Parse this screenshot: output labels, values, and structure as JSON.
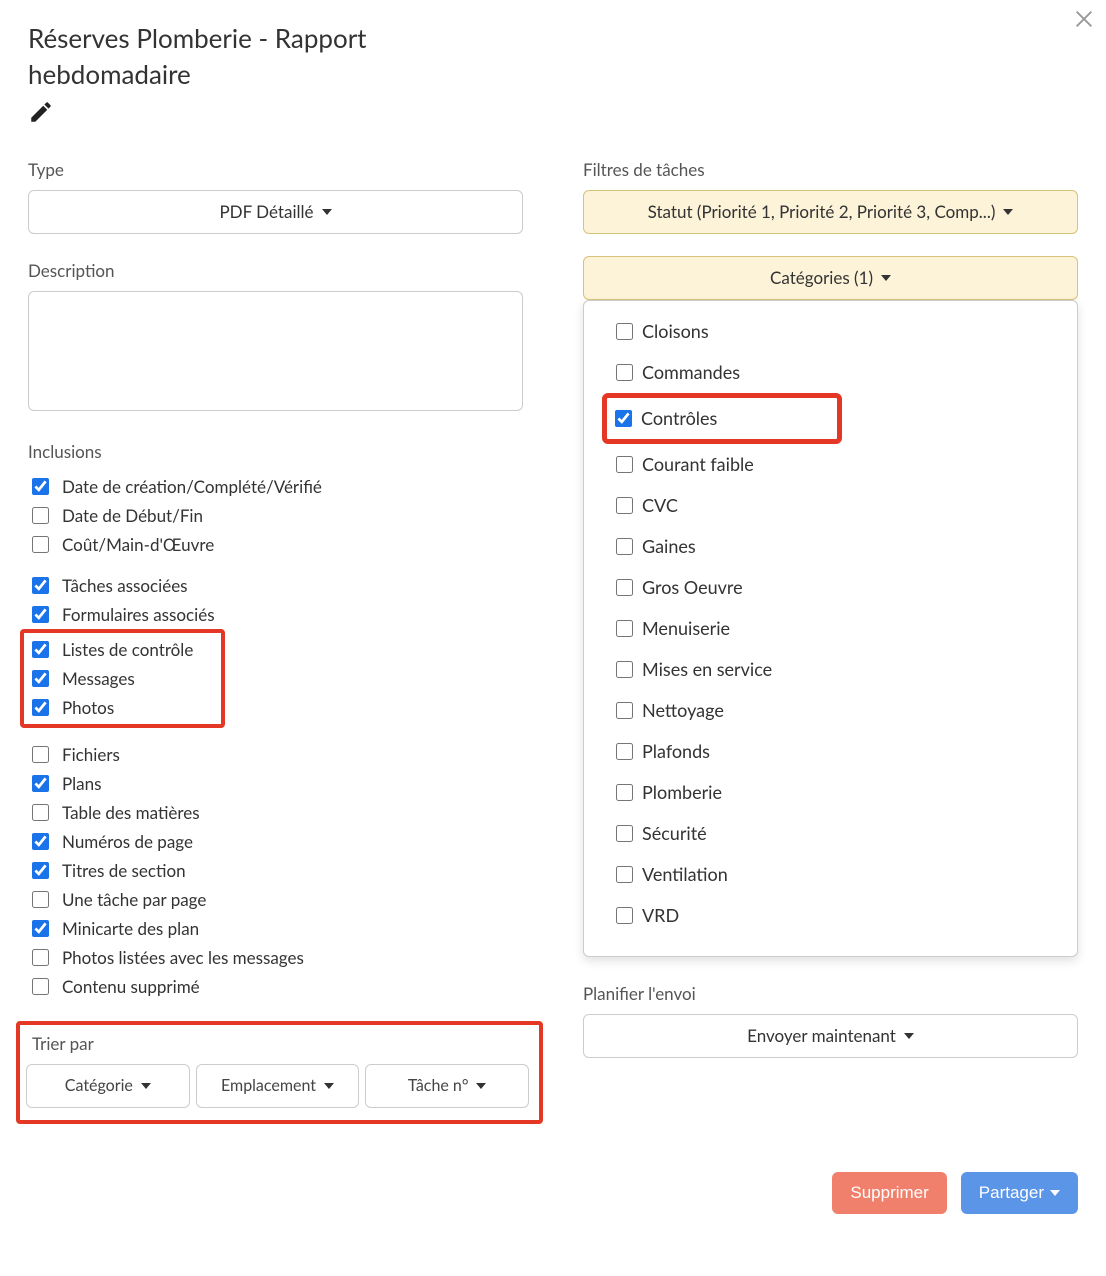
{
  "title": "Réserves Plomberie - Rapport hebdomadaire",
  "labels": {
    "type": "Type",
    "description": "Description",
    "inclusions": "Inclusions",
    "sort_by": "Trier par",
    "task_filters": "Filtres de tâches",
    "schedule": "Planifier l'envoi"
  },
  "type_dropdown": "PDF Détaillé",
  "description_value": "",
  "inclusions_items": [
    {
      "label": "Date de création/Complété/Vérifié",
      "checked": true
    },
    {
      "label": "Date de Début/Fin",
      "checked": false
    },
    {
      "label": "Coût/Main-d'Œuvre",
      "checked": false
    }
  ],
  "inclusions_items2": [
    {
      "label": "Tâches associées",
      "checked": true
    },
    {
      "label": "Formulaires associés",
      "checked": true
    }
  ],
  "inclusions_red": [
    {
      "label": "Listes de contrôle",
      "checked": true
    },
    {
      "label": "Messages",
      "checked": true
    },
    {
      "label": "Photos",
      "checked": true
    }
  ],
  "inclusions_items3": [
    {
      "label": "Fichiers",
      "checked": false
    },
    {
      "label": "Plans",
      "checked": true
    },
    {
      "label": "Table des matières",
      "checked": false
    },
    {
      "label": "Numéros de page",
      "checked": true
    },
    {
      "label": "Titres de section",
      "checked": true
    },
    {
      "label": "Une tâche par page",
      "checked": false
    },
    {
      "label": "Minicarte des plan",
      "checked": true
    },
    {
      "label": "Photos listées avec les messages",
      "checked": false
    },
    {
      "label": "Contenu supprimé",
      "checked": false
    }
  ],
  "sort_buttons": [
    "Catégorie",
    "Emplacement",
    "Tâche n°"
  ],
  "filter_status": "Statut (Priorité 1, Priorité 2, Priorité 3, Comp...)",
  "filter_categories": "Catégories (1)",
  "categories": [
    {
      "label": "Cloisons",
      "checked": false
    },
    {
      "label": "Commandes",
      "checked": false
    },
    {
      "label": "Contrôles",
      "checked": true,
      "highlight": true
    },
    {
      "label": "Courant faible",
      "checked": false
    },
    {
      "label": "CVC",
      "checked": false
    },
    {
      "label": "Gaines",
      "checked": false
    },
    {
      "label": "Gros Oeuvre",
      "checked": false
    },
    {
      "label": "Menuiserie",
      "checked": false
    },
    {
      "label": "Mises en service",
      "checked": false
    },
    {
      "label": "Nettoyage",
      "checked": false
    },
    {
      "label": "Plafonds",
      "checked": false
    },
    {
      "label": "Plomberie",
      "checked": false
    },
    {
      "label": "Sécurité",
      "checked": false
    },
    {
      "label": "Ventilation",
      "checked": false
    },
    {
      "label": "VRD",
      "checked": false
    }
  ],
  "schedule_btn": "Envoyer maintenant",
  "footer": {
    "delete": "Supprimer",
    "share": "Partager"
  }
}
